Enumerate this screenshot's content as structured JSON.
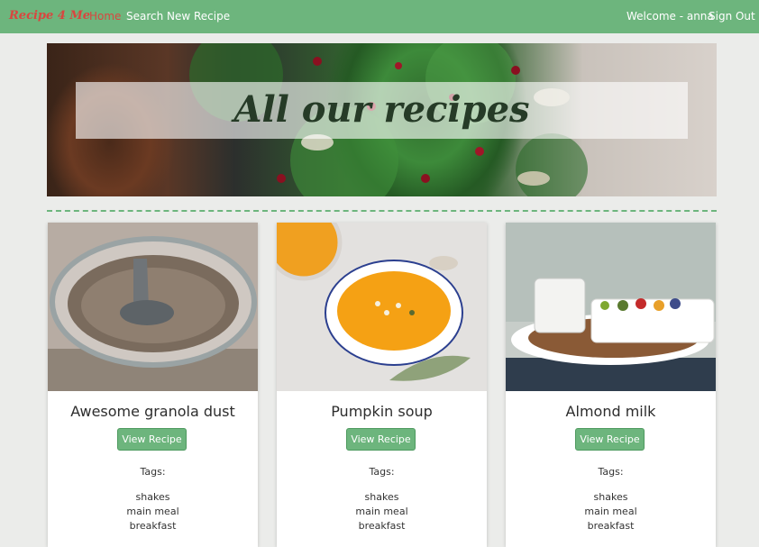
{
  "navbar": {
    "brand": "Recipe 4 Me",
    "links": [
      "Home",
      "Search",
      "New Recipe"
    ],
    "welcome": "Welcome - anna",
    "sign_out": "Sign Out",
    "colors": {
      "bar": "#6db57d",
      "brand": "#d9463f",
      "active_link": "#d9463f"
    }
  },
  "hero": {
    "title": "All our recipes",
    "image": "salad-photo"
  },
  "cards": [
    {
      "title": "Awesome granola dust",
      "button": "View Recipe",
      "tags_label": "Tags:",
      "tags": [
        "shakes",
        "main meal",
        "breakfast"
      ],
      "image": "granola-jar-photo"
    },
    {
      "title": "Pumpkin soup",
      "button": "View Recipe",
      "tags_label": "Tags:",
      "tags": [
        "shakes",
        "main meal",
        "breakfast"
      ],
      "image": "pumpkin-soup-photo"
    },
    {
      "title": "Almond milk",
      "button": "View Recipe",
      "tags_label": "Tags:",
      "tags": [
        "shakes",
        "main meal",
        "breakfast"
      ],
      "image": "almond-milk-photo"
    }
  ]
}
